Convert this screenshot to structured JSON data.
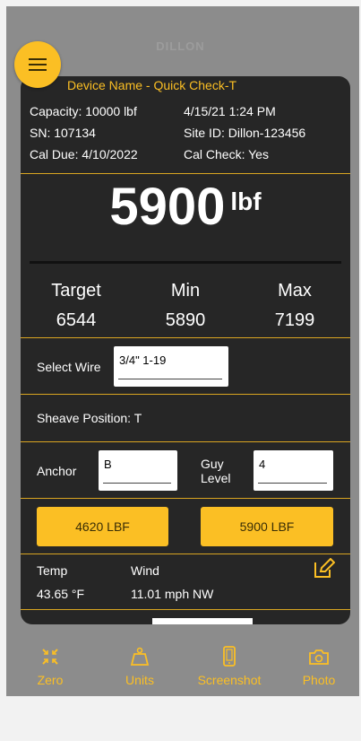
{
  "brand": "DILLON",
  "device": {
    "name_line": "Device Name  -  Quick Check-T",
    "capacity": "Capacity: 10000 lbf",
    "datetime": "4/15/21 1:24 PM",
    "sn": "SN: 107134",
    "site_id": "Site ID: Dillon-123456",
    "cal_due": "Cal Due:  4/10/2022",
    "cal_check": "Cal Check: Yes"
  },
  "reading": {
    "value": "5900",
    "unit": "lbf"
  },
  "limits": {
    "target_label": "Target",
    "target_value": "6544",
    "min_label": "Min",
    "min_value": "5890",
    "max_label": "Max",
    "max_value": "7199"
  },
  "wire": {
    "label": "Select Wire",
    "value": "3/4\" 1-19"
  },
  "sheave": {
    "text": "Sheave Position:  T"
  },
  "anchor": {
    "label": "Anchor",
    "value": "B"
  },
  "guy_level": {
    "label_line1": "Guy",
    "label_line2": "Level",
    "value": "4"
  },
  "buttons": {
    "left": "4620 LBF",
    "right": "5900 LBF"
  },
  "env": {
    "temp_label": "Temp",
    "temp_value": "43.65 °F",
    "wind_label": "Wind",
    "wind_value": "11.01 mph  NW"
  },
  "tabs": [
    {
      "label": "Zero",
      "icon": "zero-icon"
    },
    {
      "label": "Units",
      "icon": "weight-icon"
    },
    {
      "label": "Screenshot",
      "icon": "phone-icon"
    },
    {
      "label": "Photo",
      "icon": "camera-icon"
    }
  ],
  "colors": {
    "accent": "#fbbf24",
    "card": "#262626",
    "background": "#8c8c8c"
  }
}
